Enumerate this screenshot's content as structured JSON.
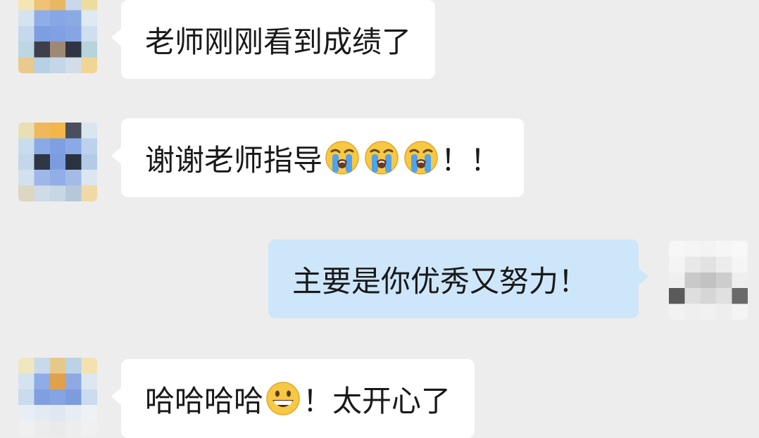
{
  "messages": [
    {
      "direction": "incoming",
      "segments": [
        {
          "type": "text",
          "value": "老师刚刚看到成绩了"
        }
      ]
    },
    {
      "direction": "incoming",
      "segments": [
        {
          "type": "text",
          "value": "谢谢老师指导"
        },
        {
          "type": "emoji",
          "icon": "loudly-crying-face-icon"
        },
        {
          "type": "emoji",
          "icon": "loudly-crying-face-icon"
        },
        {
          "type": "emoji",
          "icon": "loudly-crying-face-icon"
        },
        {
          "type": "text",
          "value": "！！"
        }
      ]
    },
    {
      "direction": "outgoing",
      "segments": [
        {
          "type": "text",
          "value": "主要是你优秀又努力！"
        }
      ]
    },
    {
      "direction": "incoming",
      "segments": [
        {
          "type": "text",
          "value": "哈哈哈哈"
        },
        {
          "type": "emoji",
          "icon": "grinning-face-icon"
        },
        {
          "type": "text",
          "value": "！太开心了"
        }
      ]
    }
  ],
  "colors": {
    "background": "#ededed",
    "incoming_bubble": "#ffffff",
    "outgoing_bubble": "#cde6fa",
    "text": "#191919"
  }
}
